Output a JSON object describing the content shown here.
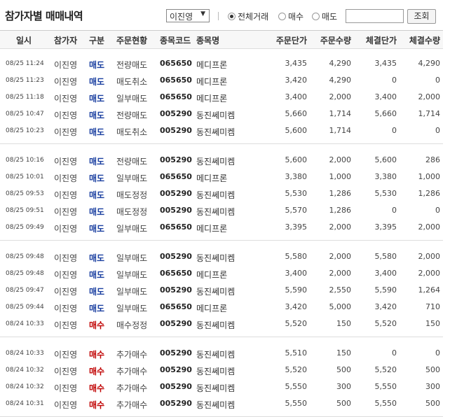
{
  "title": "참가자별 매매내역",
  "participant_select": {
    "value": "이진영",
    "arrow": "▼"
  },
  "filters": [
    {
      "label": "전체거래",
      "checked": true
    },
    {
      "label": "매수",
      "checked": false
    },
    {
      "label": "매도",
      "checked": false
    }
  ],
  "search": {
    "value": "",
    "button_label": "조회"
  },
  "columns": [
    "일시",
    "참가자",
    "구분",
    "주문현황",
    "종목코드",
    "종목명",
    "주문단가",
    "주문수량",
    "체결단가",
    "체결수량"
  ],
  "groups": [
    [
      {
        "time": "08/25 11:24",
        "name": "이진영",
        "side": "매도",
        "status": "전량매도",
        "code": "065650",
        "stock": "메디프론",
        "order_price": "3,435",
        "order_qty": "4,290",
        "exec_price": "3,435",
        "exec_qty": "4,290"
      },
      {
        "time": "08/25 11:23",
        "name": "이진영",
        "side": "매도",
        "status": "매도취소",
        "code": "065650",
        "stock": "메디프론",
        "order_price": "3,420",
        "order_qty": "4,290",
        "exec_price": "0",
        "exec_qty": "0"
      },
      {
        "time": "08/25 11:18",
        "name": "이진영",
        "side": "매도",
        "status": "일부매도",
        "code": "065650",
        "stock": "메디프론",
        "order_price": "3,400",
        "order_qty": "2,000",
        "exec_price": "3,400",
        "exec_qty": "2,000"
      },
      {
        "time": "08/25 10:47",
        "name": "이진영",
        "side": "매도",
        "status": "전량매도",
        "code": "005290",
        "stock": "동진쎄미켐",
        "order_price": "5,660",
        "order_qty": "1,714",
        "exec_price": "5,660",
        "exec_qty": "1,714"
      },
      {
        "time": "08/25 10:23",
        "name": "이진영",
        "side": "매도",
        "status": "매도취소",
        "code": "005290",
        "stock": "동진쎄미켐",
        "order_price": "5,600",
        "order_qty": "1,714",
        "exec_price": "0",
        "exec_qty": "0"
      }
    ],
    [
      {
        "time": "08/25 10:16",
        "name": "이진영",
        "side": "매도",
        "status": "전량매도",
        "code": "005290",
        "stock": "동진쎄미켐",
        "order_price": "5,600",
        "order_qty": "2,000",
        "exec_price": "5,600",
        "exec_qty": "286"
      },
      {
        "time": "08/25 10:01",
        "name": "이진영",
        "side": "매도",
        "status": "일부매도",
        "code": "065650",
        "stock": "메디프론",
        "order_price": "3,380",
        "order_qty": "1,000",
        "exec_price": "3,380",
        "exec_qty": "1,000"
      },
      {
        "time": "08/25 09:53",
        "name": "이진영",
        "side": "매도",
        "status": "매도정정",
        "code": "005290",
        "stock": "동진쎄미켐",
        "order_price": "5,530",
        "order_qty": "1,286",
        "exec_price": "5,530",
        "exec_qty": "1,286"
      },
      {
        "time": "08/25 09:51",
        "name": "이진영",
        "side": "매도",
        "status": "매도정정",
        "code": "005290",
        "stock": "동진쎄미켐",
        "order_price": "5,570",
        "order_qty": "1,286",
        "exec_price": "0",
        "exec_qty": "0"
      },
      {
        "time": "08/25 09:49",
        "name": "이진영",
        "side": "매도",
        "status": "일부매도",
        "code": "065650",
        "stock": "메디프론",
        "order_price": "3,395",
        "order_qty": "2,000",
        "exec_price": "3,395",
        "exec_qty": "2,000"
      }
    ],
    [
      {
        "time": "08/25 09:48",
        "name": "이진영",
        "side": "매도",
        "status": "일부매도",
        "code": "005290",
        "stock": "동진쎄미켐",
        "order_price": "5,580",
        "order_qty": "2,000",
        "exec_price": "5,580",
        "exec_qty": "2,000"
      },
      {
        "time": "08/25 09:48",
        "name": "이진영",
        "side": "매도",
        "status": "일부매도",
        "code": "065650",
        "stock": "메디프론",
        "order_price": "3,400",
        "order_qty": "2,000",
        "exec_price": "3,400",
        "exec_qty": "2,000"
      },
      {
        "time": "08/25 09:47",
        "name": "이진영",
        "side": "매도",
        "status": "일부매도",
        "code": "005290",
        "stock": "동진쎄미켐",
        "order_price": "5,590",
        "order_qty": "2,550",
        "exec_price": "5,590",
        "exec_qty": "1,264"
      },
      {
        "time": "08/25 09:44",
        "name": "이진영",
        "side": "매도",
        "status": "일부매도",
        "code": "065650",
        "stock": "메디프론",
        "order_price": "3,420",
        "order_qty": "5,000",
        "exec_price": "3,420",
        "exec_qty": "710"
      },
      {
        "time": "08/24 10:33",
        "name": "이진영",
        "side": "매수",
        "status": "매수정정",
        "code": "005290",
        "stock": "동진쎄미켐",
        "order_price": "5,520",
        "order_qty": "150",
        "exec_price": "5,520",
        "exec_qty": "150"
      }
    ],
    [
      {
        "time": "08/24 10:33",
        "name": "이진영",
        "side": "매수",
        "status": "추가매수",
        "code": "005290",
        "stock": "동진쎄미켐",
        "order_price": "5,510",
        "order_qty": "150",
        "exec_price": "0",
        "exec_qty": "0"
      },
      {
        "time": "08/24 10:32",
        "name": "이진영",
        "side": "매수",
        "status": "추가매수",
        "code": "005290",
        "stock": "동진쎄미켐",
        "order_price": "5,520",
        "order_qty": "500",
        "exec_price": "5,520",
        "exec_qty": "500"
      },
      {
        "time": "08/24 10:32",
        "name": "이진영",
        "side": "매수",
        "status": "추가매수",
        "code": "005290",
        "stock": "동진쎄미켐",
        "order_price": "5,550",
        "order_qty": "300",
        "exec_price": "5,550",
        "exec_qty": "300"
      },
      {
        "time": "08/24 10:31",
        "name": "이진영",
        "side": "매수",
        "status": "추가매수",
        "code": "005290",
        "stock": "동진쎄미켐",
        "order_price": "5,550",
        "order_qty": "500",
        "exec_price": "5,550",
        "exec_qty": "500"
      }
    ]
  ],
  "colors": {
    "sell": "#1a3fa0",
    "buy": "#c00000"
  }
}
